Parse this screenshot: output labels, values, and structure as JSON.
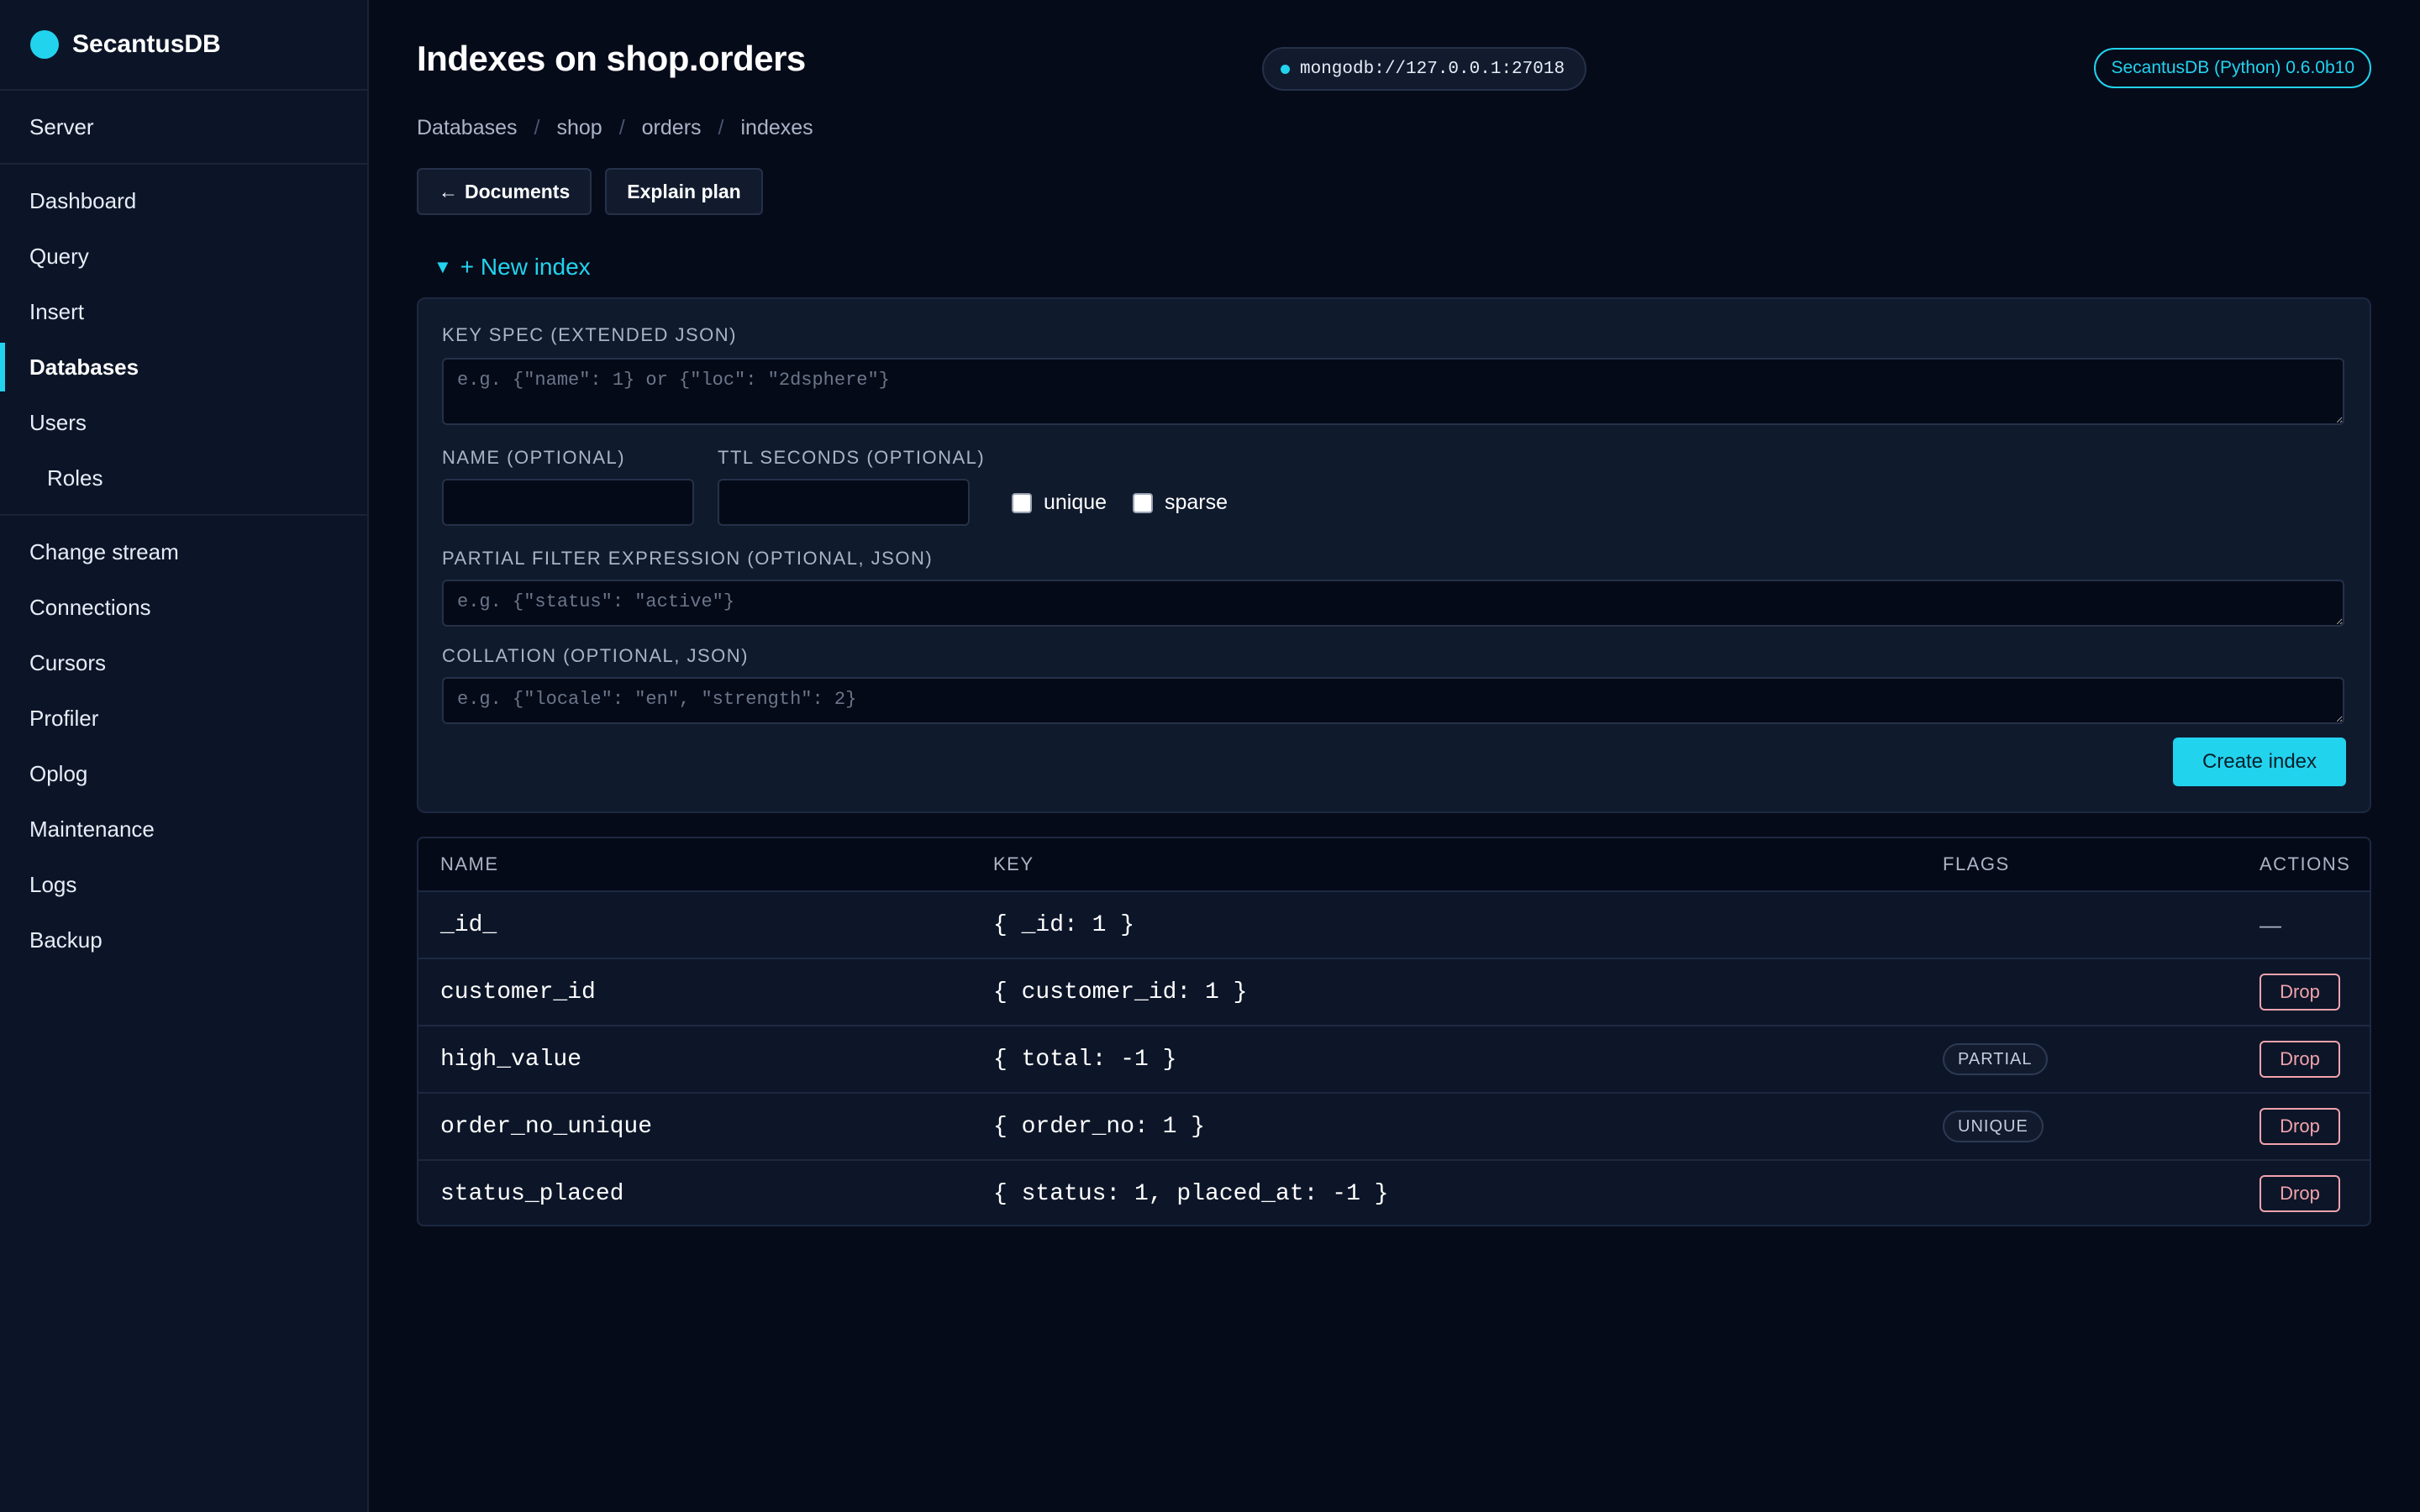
{
  "app": {
    "name": "SecantusDB"
  },
  "sidebar": {
    "sections": [
      [
        {
          "label": "Server"
        }
      ],
      [
        {
          "label": "Dashboard"
        },
        {
          "label": "Query"
        },
        {
          "label": "Insert"
        },
        {
          "label": "Databases",
          "active": true
        },
        {
          "label": "Users"
        },
        {
          "label": "Roles",
          "sub": true
        }
      ],
      [
        {
          "label": "Change stream"
        },
        {
          "label": "Connections"
        },
        {
          "label": "Cursors"
        },
        {
          "label": "Profiler"
        },
        {
          "label": "Oplog"
        },
        {
          "label": "Maintenance"
        },
        {
          "label": "Logs"
        },
        {
          "label": "Backup"
        }
      ]
    ]
  },
  "header": {
    "title": "Indexes on shop.orders",
    "connection": "mongodb://127.0.0.1:27018",
    "version": "SecantusDB (Python) 0.6.0b10"
  },
  "breadcrumb": [
    "Databases",
    "shop",
    "orders",
    "indexes"
  ],
  "buttons": {
    "documents": "Documents",
    "documents_arrow": "←",
    "explain": "Explain plan"
  },
  "new_index": {
    "toggle_caret": "▼",
    "toggle_label": "+ New index",
    "key_spec_label": "KEY SPEC (EXTENDED JSON)",
    "key_spec_placeholder": "e.g. {\"name\": 1} or {\"loc\": \"2dsphere\"}",
    "name_label": "NAME (OPTIONAL)",
    "ttl_label": "TTL SECONDS (OPTIONAL)",
    "unique_label": "unique",
    "sparse_label": "sparse",
    "partial_label": "PARTIAL FILTER EXPRESSION (OPTIONAL, JSON)",
    "partial_placeholder": "e.g. {\"status\": \"active\"}",
    "collation_label": "COLLATION (OPTIONAL, JSON)",
    "collation_placeholder": "e.g. {\"locale\": \"en\", \"strength\": 2}",
    "create_label": "Create index"
  },
  "table": {
    "headers": {
      "name": "NAME",
      "key": "KEY",
      "flags": "FLAGS",
      "actions": "ACTIONS"
    },
    "drop_label": "Drop",
    "no_action": "—",
    "rows": [
      {
        "name": "_id_",
        "key": "{ _id: 1 }",
        "flag": "",
        "droppable": false
      },
      {
        "name": "customer_id",
        "key": "{ customer_id: 1 }",
        "flag": "",
        "droppable": true
      },
      {
        "name": "high_value",
        "key": "{ total: -1 }",
        "flag": "PARTIAL",
        "droppable": true
      },
      {
        "name": "order_no_unique",
        "key": "{ order_no: 1 }",
        "flag": "UNIQUE",
        "droppable": true
      },
      {
        "name": "status_placed",
        "key": "{ status: 1, placed_at: -1 }",
        "flag": "",
        "droppable": true
      }
    ]
  },
  "colors": {
    "accent": "#22d3ee",
    "danger": "#f2a3ac",
    "background": "#060b1a"
  }
}
